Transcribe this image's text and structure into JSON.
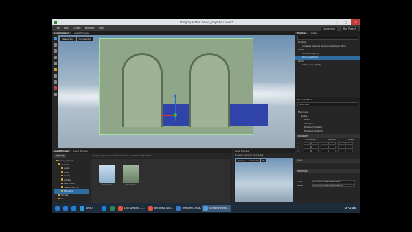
{
  "window": {
    "title": "Stingray Editor: basic_project2 / basic*"
  },
  "menu": {
    "items": [
      "File",
      "Edit",
      "Create",
      "Window",
      "Help"
    ],
    "status": "Connecting",
    "run_label": "Run Project"
  },
  "viewport": {
    "tabs": [
      "Level Viewport",
      "Asset Preview"
    ],
    "toolbar": [
      "Perspective",
      "Full Render"
    ]
  },
  "explorer": {
    "tabs": [
      "Explorer",
      "Create"
    ],
    "filter_placeholder": "",
    "items": [
      {
        "label": "Entities",
        "selected": false
      },
      {
        "label": "underlay_reading_environment(overriding)",
        "selected": false
      },
      {
        "label": "Units",
        "selected": false
      },
      {
        "label": "character (Unit)",
        "selected": false
      },
      {
        "label": "Structure (Unit)",
        "selected": true
      },
      {
        "label": "Lights",
        "selected": false
      },
      {
        "label": "light_source (Unit)",
        "selected": false
      }
    ]
  },
  "property_editor": {
    "title": "Property Editor",
    "name": "Structure",
    "tree": [
      "Structure",
      "Nodes",
      "Room",
      "Structure",
      "WindowFrameLeft",
      "WindowFrameRight"
    ],
    "sections": {
      "transform": "Transform",
      "grid": "Grid",
      "materials": "Materials"
    },
    "transform_headers": [
      "Translation",
      "Rotation",
      "Scale"
    ],
    "transform_rows": [
      {
        "axis": "X",
        "t": "0",
        "r": "0",
        "s": "1"
      },
      {
        "axis": "Y",
        "t": "0",
        "r": "0",
        "s": "1"
      },
      {
        "axis": "Z",
        "t": "0",
        "r": "0",
        "s": "1"
      }
    ],
    "material_rows": [
      {
        "label": "Floor",
        "value": "content/levels/materials/flo"
      },
      {
        "label": "Walls",
        "value": "content/levels/materials/stru"
      }
    ]
  },
  "asset_browser": {
    "tabs": [
      "Asset Browser",
      "Level Browser"
    ],
    "import_label": "IMPORT",
    "path": "basic_project2 > content > levels > models > Structure",
    "folders": [
      "basic_project2",
      "content",
      "audio",
      "fonts",
      "levels",
      "models",
      "new folder",
      "New folder (2)",
      "Structure",
      "Scripts",
      "ui"
    ],
    "selected_folder": "Room",
    "assets": [
      {
        "name": "materials",
        "kind": "folder"
      },
      {
        "name": "Structure",
        "kind": "model"
      }
    ]
  },
  "asset_preview": {
    "title": "Asset Preview",
    "label": "No asset selected for preview",
    "toolbar": [
      "Preview",
      "Full Render",
      "Fit"
    ]
  },
  "status": {
    "console": "Console",
    "log_tab": "Status Engine",
    "message": "Modified Property Panel - Selection"
  },
  "taskbar": {
    "items": [
      {
        "label": "",
        "color": "#2b7bd1"
      },
      {
        "label": "",
        "color": "#2b7bd1"
      },
      {
        "label": "",
        "color": "#1e7fd6"
      },
      {
        "label": "LVMO",
        "color": "#2a9bd8"
      },
      {
        "label": "",
        "color": "#1e7fd6"
      },
      {
        "label": "",
        "color": "#2e8b57"
      },
      {
        "label": "LIVE Design - L...",
        "color": "#e5533c"
      },
      {
        "label": "autodesk-stin...",
        "color": "#e5533c"
      },
      {
        "label": "Thelcz907.mas...",
        "color": "#3a78c2"
      },
      {
        "label": "Stingray Edito...",
        "color": "#5b9bd5"
      }
    ],
    "time": "8:58 AM"
  },
  "colors": {
    "selection": "#9fe39f",
    "floor": "#2f43a8",
    "highlight": "#2f6da3"
  }
}
